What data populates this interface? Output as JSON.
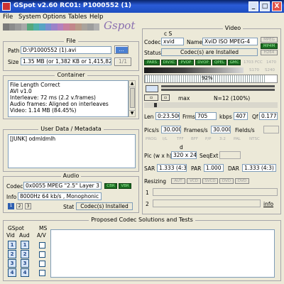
{
  "window": {
    "title": "GSpot v2.60 RC01: P1000552 (1)",
    "buttons": [
      "_",
      "□",
      "X"
    ]
  },
  "menu": [
    "File",
    "System",
    "Options",
    "Tables",
    "Help"
  ],
  "logo": "Gspot",
  "color_strip": [
    "#7a7a7a",
    "#8c8c8c",
    "#9a9a9a",
    "#a8a8a8",
    "#56a87c",
    "#4fb0a8",
    "#58a4c4",
    "#7a8fd0",
    "#9b83c9",
    "#b57fbf",
    "#c77f9f",
    "#c2878a",
    "#b79a88",
    "#a9a39c",
    "#9d9d9d",
    "#b0b0b0"
  ],
  "file": {
    "title": "File",
    "path_label": "Path",
    "path_value": "D:\\P1000552 (1).avi",
    "browse_label": "...",
    "size_label": "Size",
    "size_value": "1.35 MB (or 1,382 KB or 1,415,82",
    "page_label": "1/1"
  },
  "container": {
    "title": "Container",
    "lines": [
      "File Length Correct",
      "AVI v1.0",
      "Interleave: 72 ms (2.2 v.frames)",
      "Audio frames: Aligned on interleaves",
      "Video: 1.14 MB (84.45%)"
    ]
  },
  "userdata": {
    "title": "User Data / Metadata",
    "text": "[JUNK]    odmldmlh"
  },
  "audio": {
    "title": "Audio",
    "codec_label": "Codec",
    "codec_value": "0x0055 MPEG \"2.5\" Layer 3",
    "badges": [
      "CBR",
      "VBR"
    ],
    "info_label": "Info",
    "info_value": "8000Hz  64 kb/s , Monophonic",
    "nums": [
      "1",
      "2",
      "3"
    ],
    "stat_label": "Stat",
    "stat_value": "Codec(s) Installed"
  },
  "proposed": {
    "title": "Proposed Codec Solutions and Tests",
    "gspot_label": "GSpot",
    "vid_label": "Vid",
    "aud_label": "Aud",
    "ms_label": "MS",
    "av_label": "A/V",
    "vid_nums": [
      "1",
      "2",
      "3",
      "4"
    ],
    "aud_nums": [
      "1",
      "2",
      "3",
      "4"
    ]
  },
  "video": {
    "title": "Video",
    "cs_label": "c  S",
    "codec_label": "Codec",
    "codec_value": "xvid",
    "name_label": "Name",
    "name_value": "XviD ISO MPEG-4",
    "top_badges": [
      "MPEG",
      "MP4M",
      "H264"
    ],
    "status_label": "Status",
    "status_value": "Codec(s) are Installed",
    "row_badges": [
      "PARS",
      "DIVXC",
      "PVOP",
      "DVOP",
      "QPEL",
      "GMC"
    ],
    "right_flags1": [
      "1703",
      "FCC",
      "1470"
    ],
    "right_flags2": [
      "S170",
      "S240"
    ],
    "bar_pct": "92%",
    "max_label": "max",
    "n_label": "N=12 (100%)",
    "len_label": "Len",
    "len_value": "0:23.500",
    "frms_label": "Frms",
    "frms_value": "705",
    "kbps_label": "kbps",
    "kbps_value": "407",
    "qf_label": "Qf",
    "qf_value": "0.177",
    "pics_label": "Pics/s",
    "pics_value": "30.000",
    "frames_label": "Frames/s",
    "frames_value": "30.000",
    "fields_label": "Fields/s",
    "frame_flags": [
      "PROG",
      "I/L",
      "TFF",
      "BFF",
      "P/P",
      "3:2",
      "PAL",
      "NTSC"
    ],
    "d_label": "d",
    "pic_label": "Pic (w x h)",
    "pic_value": "320 x 24",
    "seqext_label": "SeqExt",
    "sar_label": "SAR",
    "sar_value": "1.333 (4:3)",
    "par_label": "PAR",
    "par_value": "1.000",
    "dar_label": "DAR",
    "dar_value": "1.333 (4:3)",
    "resizing_label": "Resizing",
    "resize_badges": [
      "AUT",
      "VCD",
      "SVCD",
      "DVD",
      "DVD"
    ],
    "row1_label": "1",
    "row2_label": "2",
    "info_link": "info"
  }
}
